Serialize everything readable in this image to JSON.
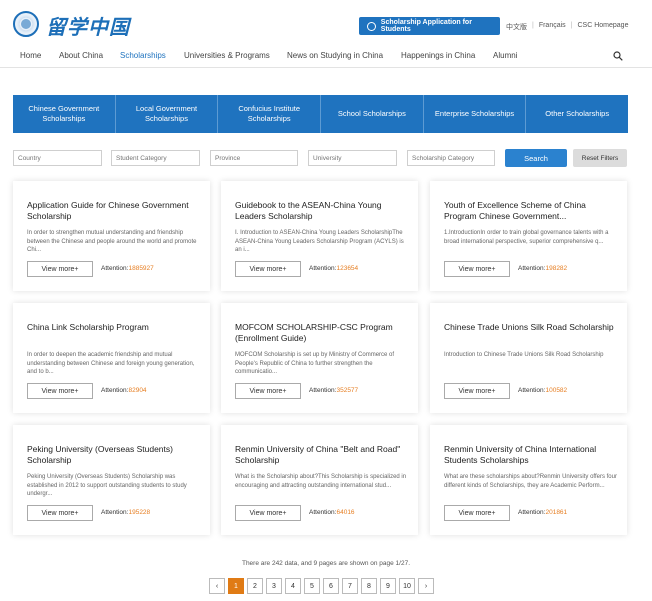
{
  "header": {
    "logo_text": "留学中国",
    "apply_button": "Scholarship Application for Students",
    "links": [
      "中文版",
      "Français",
      "CSC Homepage"
    ]
  },
  "nav": {
    "items": [
      "Home",
      "About China",
      "Scholarships",
      "Universities & Programs",
      "News on Studying in China",
      "Happenings in China",
      "Alumni"
    ],
    "active": "Scholarships"
  },
  "categories": [
    "Chinese Government Scholarships",
    "Local Government Scholarships",
    "Confucius Institute Scholarships",
    "School Scholarships",
    "Enterprise Scholarships",
    "Other Scholarships"
  ],
  "filters": {
    "country": "Country",
    "student_category": "Student Category",
    "province": "Province",
    "university": "University",
    "scholarship_category": "Scholarship Category",
    "search_label": "Search",
    "reset_label": "Reset Filters"
  },
  "cards": [
    {
      "title": "Application Guide for Chinese Government Scholarship",
      "desc": "In order to strengthen mutual understanding and friendship between the Chinese and people around the world and promote Chi...",
      "button": "View more+",
      "attention_label": "Attention:",
      "attention": "1885927"
    },
    {
      "title": "Guidebook to the ASEAN-China Young Leaders Scholarship",
      "desc": "Ⅰ. Introduction to ASEAN-China Young Leaders ScholarshipThe ASEAN-China Young Leaders Scholarship Program (ACYLS) is an i...",
      "button": "View more+",
      "attention_label": "Attention:",
      "attention": "123654"
    },
    {
      "title": "Youth of Excellence Scheme of China Program Chinese Government...",
      "desc": "1.IntroductionIn order to train global governance talents with a broad international perspective, superior comprehensive q...",
      "button": "View more+",
      "attention_label": "Attention:",
      "attention": "198282"
    },
    {
      "title": "China Link Scholarship Program",
      "desc": "In order to deepen the academic friendship and mutual understanding between Chinese and foreign young generation, and to b...",
      "button": "View more+",
      "attention_label": "Attention:",
      "attention": "82904"
    },
    {
      "title": "MOFCOM SCHOLARSHIP-CSC Program (Enrollment Guide)",
      "desc": "MOFCOM Scholarship is set up by Ministry of Commerce of People's Republic of China to further strengthen the communicatio...",
      "button": "View more+",
      "attention_label": "Attention:",
      "attention": "352577"
    },
    {
      "title": "Chinese Trade Unions Silk Road Scholarship",
      "desc": "Introduction to Chinese Trade Unions Silk Road Scholarship",
      "button": "View more+",
      "attention_label": "Attention:",
      "attention": "100582"
    },
    {
      "title": "Peking University (Overseas Students) Scholarship",
      "desc": "Peking University (Overseas Students) Scholarship was established in 2012 to support outstanding students to study undergr...",
      "button": "View more+",
      "attention_label": "Attention:",
      "attention": "195228"
    },
    {
      "title": "Renmin University of China \"Belt and Road\" Scholarship",
      "desc": "What is the Scholarship about?This Scholarship is specialized in encouraging and attracting outstanding international stud...",
      "button": "View more+",
      "attention_label": "Attention:",
      "attention": "64016"
    },
    {
      "title": "Renmin University of China International Students Scholarships",
      "desc": "What are these scholarships about?Renmin University offers four different kinds of Scholarships, they are Academic Perform...",
      "button": "View more+",
      "attention_label": "Attention:",
      "attention": "201861"
    }
  ],
  "pagination": {
    "info": "There are 242 data, and 9 pages are shown on page 1/27.",
    "prev": "‹",
    "next": "›",
    "pages": [
      "1",
      "2",
      "3",
      "4",
      "5",
      "6",
      "7",
      "8",
      "9",
      "10"
    ],
    "current": "1"
  },
  "colors": {
    "accent": "#1f73bf",
    "highlight": "#e07b15"
  }
}
